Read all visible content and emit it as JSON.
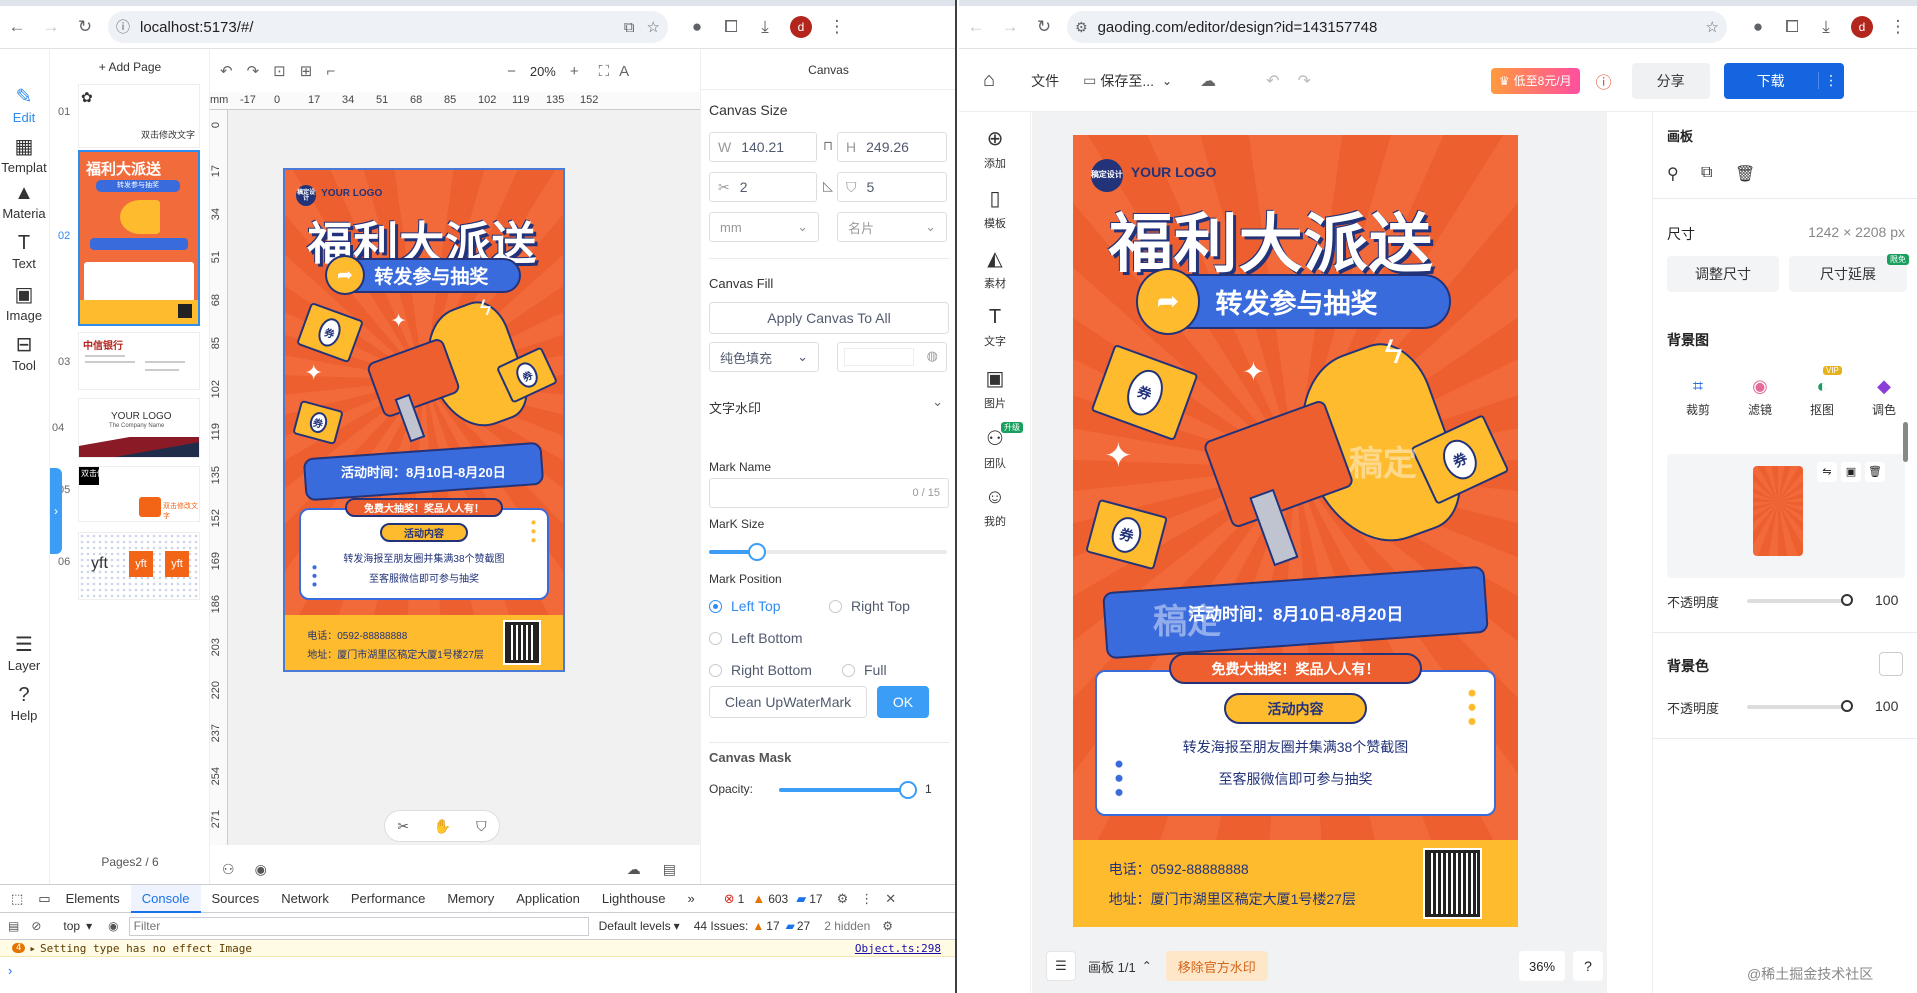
{
  "left_browser": {
    "url": "localhost:5173/#/",
    "avatar": "d"
  },
  "editor": {
    "rail": [
      {
        "name": "rail-edit",
        "label": "Edit",
        "icon": "edit-icon",
        "glyph": "✎"
      },
      {
        "name": "rail-template",
        "label": "Templat",
        "icon": "template-icon",
        "glyph": "▦"
      },
      {
        "name": "rail-material",
        "label": "Materia",
        "icon": "shapes-icon",
        "glyph": "▲"
      },
      {
        "name": "rail-text",
        "label": "Text",
        "icon": "text-icon",
        "glyph": "T"
      },
      {
        "name": "rail-image",
        "label": "Image",
        "icon": "image-icon",
        "glyph": "▣"
      },
      {
        "name": "rail-tool",
        "label": "Tool",
        "icon": "toolbox-icon",
        "glyph": "⊟"
      },
      {
        "name": "rail-layer",
        "label": "Layer",
        "icon": "layers-icon",
        "glyph": "☰"
      },
      {
        "name": "rail-help",
        "label": "Help",
        "icon": "help-icon",
        "glyph": "?"
      }
    ],
    "add_page": "+ Add Page",
    "pages": [
      {
        "no": "01",
        "text": "双击修改文字"
      },
      {
        "no": "02",
        "text": ""
      },
      {
        "no": "03",
        "text": "中信银行"
      },
      {
        "no": "04",
        "text": "YOUR LOGO",
        "sub": "The Company Name"
      },
      {
        "no": "05",
        "text": "双击修改文字",
        "text2": "双击修改文字"
      },
      {
        "no": "06",
        "text": "yft"
      }
    ],
    "pages_counter": "Pages2 / 6",
    "zoom": "20%",
    "canvas_tab": "Canvas",
    "ruler_top": [
      "-17",
      "0",
      "17",
      "34",
      "51",
      "68",
      "85",
      "102",
      "119",
      "135",
      "152"
    ],
    "ruler_left": [
      "0",
      "17",
      "34",
      "51",
      "68",
      "85",
      "102",
      "119",
      "135",
      "152",
      "169",
      "186",
      "203",
      "220",
      "237",
      "254",
      "271"
    ],
    "ruler_unit": "mm",
    "panel": {
      "canvas_size": "Canvas Size",
      "w_label": "W",
      "w": "140.21",
      "h_label": "H",
      "h": "249.26",
      "bleed": "2",
      "radius": "5",
      "unit": "mm",
      "type": "名片",
      "canvas_fill": "Canvas Fill",
      "apply_all": "Apply Canvas To All",
      "fill_mode": "纯色填充",
      "watermark": "文字水印",
      "mark_name": "Mark Name",
      "mark_count": "0 / 15",
      "mark_size": "MarK Size",
      "mark_size_value": 0.2,
      "mark_position": "Mark Position",
      "positions": [
        "Left Top",
        "Right Top",
        "Left Bottom",
        "Right Bottom",
        "Full"
      ],
      "clean_btn": "Clean UpWaterMark",
      "ok_btn": "OK",
      "canvas_mask": "Canvas Mask",
      "opacity_label": "Opacity:",
      "opacity_value": "1"
    }
  },
  "poster": {
    "logo": "YOUR LOGO",
    "logo_badge": "稿定设计",
    "title": "福利大派送",
    "subtitle": "转发参与抽奖",
    "coupon": "券",
    "date": "活动时间：8月10日-8月20日",
    "banner": "免费大抽奖！奖品人人有！",
    "content_title": "活动内容",
    "content_line1": "转发海报至朋友圈并集满38个赞截图",
    "content_line2": "至客服微信即可参与抽奖",
    "phone": "电话：0592-88888888",
    "address": "地址：厦门市湖里区稿定大厦1号楼27层",
    "watermark": "稿定"
  },
  "devtools": {
    "tabs": [
      "Elements",
      "Console",
      "Sources",
      "Network",
      "Performance",
      "Memory",
      "Application",
      "Lighthouse"
    ],
    "active_tab": "Console",
    "errors": "1",
    "warnings": "603",
    "infos": "17",
    "context": "top",
    "filter_placeholder": "Filter",
    "levels": "Default levels",
    "issues_label": "44 Issues:",
    "issues_warn": "17",
    "issues_info": "27",
    "hidden": "2 hidden",
    "log_count": "4",
    "log_text": "Setting type has no effect Image",
    "log_source": "Object.ts:298"
  },
  "right_browser": {
    "url": "gaoding.com/editor/design?id=143157748",
    "avatar": "d"
  },
  "gaoding": {
    "file_menu": "文件",
    "save": "保存至...",
    "promo": "低至8元/月",
    "share": "分享",
    "download": "下载",
    "sidebar": [
      {
        "name": "side-add",
        "label": "添加",
        "icon": "plus-circle-icon",
        "glyph": "⊕"
      },
      {
        "name": "side-template",
        "label": "模板",
        "icon": "template-icon",
        "glyph": "▯"
      },
      {
        "name": "side-material",
        "label": "素材",
        "icon": "shapes-icon",
        "glyph": "◭"
      },
      {
        "name": "side-text",
        "label": "文字",
        "icon": "text-icon",
        "glyph": "T"
      },
      {
        "name": "side-image",
        "label": "图片",
        "icon": "image-icon",
        "glyph": "▣"
      },
      {
        "name": "side-team",
        "label": "团队",
        "icon": "team-icon",
        "glyph": "⚇"
      },
      {
        "name": "side-mine",
        "label": "我的",
        "icon": "user-icon",
        "glyph": "☺"
      }
    ],
    "team_badge": "升级",
    "panel": {
      "artboard": "画板",
      "size_label": "尺寸",
      "size_value": "1242 × 2208 px",
      "resize": "调整尺寸",
      "extend": "尺寸延展",
      "extend_badge": "限免",
      "bg_image": "背景图",
      "tools": [
        {
          "label": "裁剪",
          "icon": "crop-icon",
          "glyph": "⌗",
          "color": "#2d6be4"
        },
        {
          "label": "滤镜",
          "icon": "filter-icon",
          "glyph": "◉",
          "color": "#e36c9a"
        },
        {
          "label": "抠图",
          "icon": "cutout-icon",
          "glyph": "◐",
          "color": "#1aa05e"
        },
        {
          "label": "调色",
          "icon": "adjust-color-icon",
          "glyph": "◆",
          "color": "#8b3fd9"
        }
      ],
      "vip": "VIP",
      "opacity_label": "不透明度",
      "opacity_value": "100",
      "bg_color": "背景色",
      "opacity2_label": "不透明度",
      "opacity2_value": "100"
    },
    "bottom": {
      "artboard": "画板 1/1",
      "remove_watermark": "移除官方水印",
      "zoom": "36%",
      "help": "?"
    },
    "site_watermark": "@稀土掘金技术社区"
  },
  "colors": {
    "poster_orange": "#f26b3a",
    "poster_blue": "#3a6bdc",
    "poster_yellow": "#fdbb2d",
    "accent_blue": "#2d8cf0",
    "gaoding_blue": "#1665e0"
  }
}
